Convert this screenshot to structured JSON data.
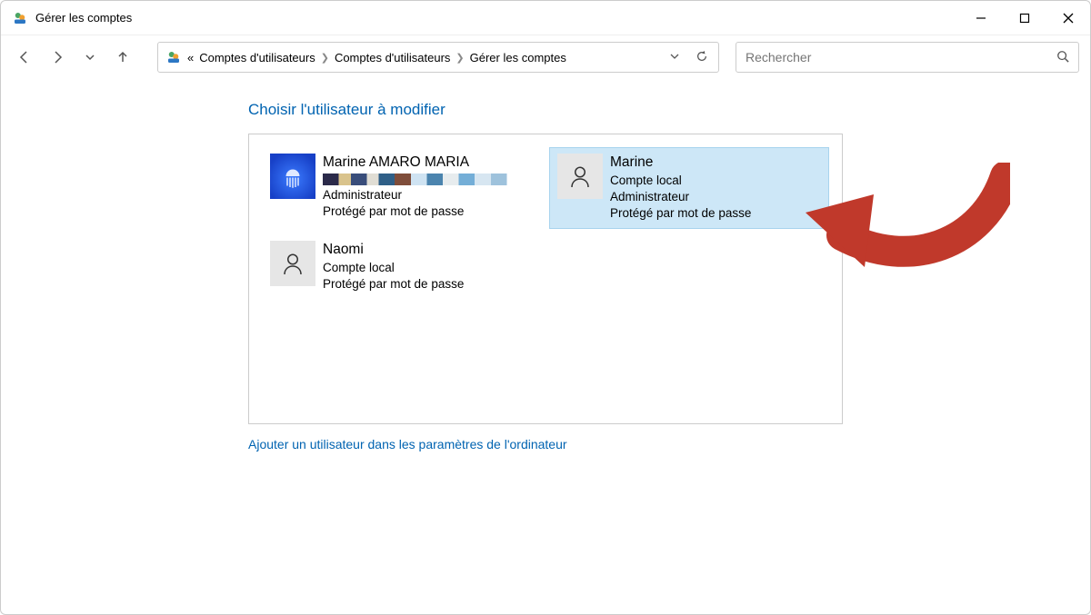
{
  "window": {
    "title": "Gérer les comptes"
  },
  "breadcrumb": {
    "prefix": "«",
    "items": [
      "Comptes d'utilisateurs",
      "Comptes d'utilisateurs",
      "Gérer les comptes"
    ]
  },
  "search": {
    "placeholder": "Rechercher"
  },
  "section": {
    "title": "Choisir l'utilisateur à modifier"
  },
  "users": [
    {
      "name": "Marine AMARO MARIA",
      "email_obscured": true,
      "lines": [
        "Administrateur",
        "Protégé par mot de passe"
      ],
      "avatar_style": "blue-jellyfish",
      "selected": false
    },
    {
      "name": "Marine",
      "lines": [
        "Compte local",
        "Administrateur",
        "Protégé par mot de passe"
      ],
      "avatar_style": "default",
      "selected": true
    },
    {
      "name": "Naomi",
      "lines": [
        "Compte local",
        "Protégé par mot de passe"
      ],
      "avatar_style": "default",
      "selected": false
    }
  ],
  "add_user_link": "Ajouter un utilisateur dans les paramètres de l'ordinateur"
}
